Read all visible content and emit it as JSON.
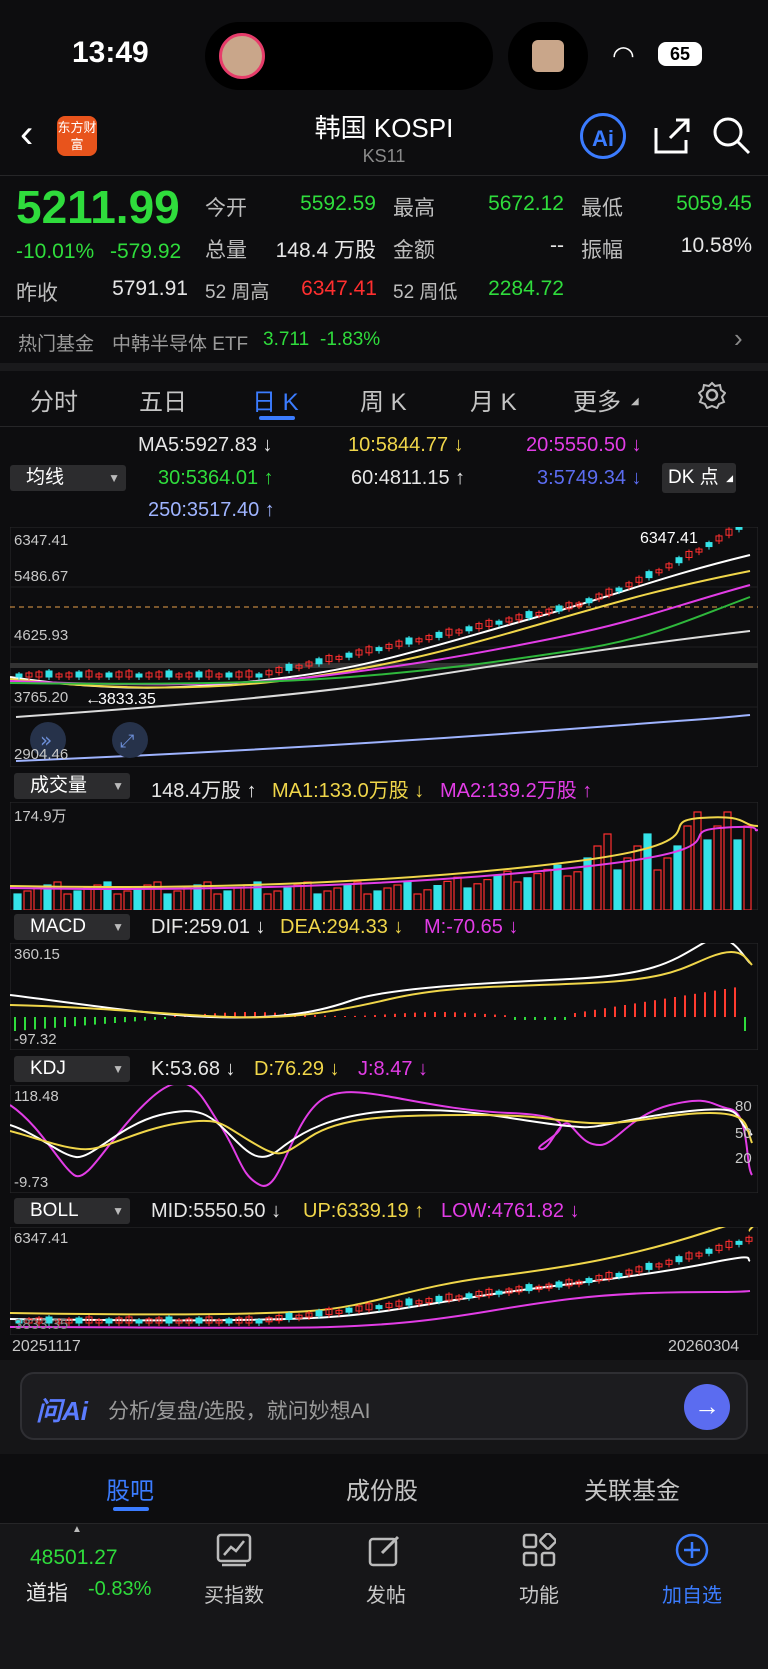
{
  "status": {
    "time": "13:49",
    "battery": "65"
  },
  "header": {
    "title": "韩国 KOSPI",
    "code": "KS11",
    "logo_text": "东方财富",
    "ai_label": "Ai"
  },
  "quote": {
    "price": "5211.99",
    "change_pct": "-10.01%",
    "change": "-579.92",
    "open_label": "今开",
    "open": "5592.59",
    "high_label": "最高",
    "high": "5672.12",
    "low_label": "最低",
    "low": "5059.45",
    "volume_label": "总量",
    "volume": "148.4 万股",
    "amount_label": "金额",
    "amount": "--",
    "amplitude_label": "振幅",
    "amplitude": "10.58%",
    "prev_close_label": "昨收",
    "prev_close": "5791.91",
    "w52_high_label": "52 周高",
    "w52_high": "6347.41",
    "w52_low_label": "52 周低",
    "w52_low": "2284.72"
  },
  "fund": {
    "label": "热门基金",
    "name": "中韩半导体 ETF",
    "price": "3.711",
    "change": "-1.83%"
  },
  "tabs": [
    "分时",
    "五日",
    "日 K",
    "周 K",
    "月 K",
    "更多"
  ],
  "ma": {
    "selector": "均线",
    "ma5": "MA5:5927.83 ↓",
    "ma10": "10:5844.77 ↓",
    "ma20": "20:5550.50 ↓",
    "ma30": "30:5364.01 ↑",
    "ma60": "60:4811.15 ↑",
    "ma3": "3:5749.34 ↓",
    "ma250": "250:3517.40 ↑",
    "dk": "DK 点"
  },
  "kline": {
    "p_top": "6347.41",
    "p2": "5486.67",
    "p3": "4625.93",
    "p4": "3765.20",
    "p_bot": "2904.46",
    "max_mark": "6347.41",
    "min_mark": "3833.35"
  },
  "volume": {
    "selector": "成交量",
    "vol": "148.4万股 ↑",
    "ma1": "MA1:133.0万股 ↓",
    "ma2": "MA2:139.2万股 ↑",
    "top": "174.9万"
  },
  "macd": {
    "selector": "MACD",
    "dif": "DIF:259.01 ↓",
    "dea": "DEA:294.33 ↓",
    "m": "M:-70.65 ↓",
    "top": "360.15",
    "bot": "-97.32"
  },
  "kdj": {
    "selector": "KDJ",
    "k": "K:53.68 ↓",
    "d": "D:76.29 ↓",
    "j": "J:8.47 ↓",
    "top": "118.48",
    "bot": "-9.73",
    "l80": "80",
    "l50": "50",
    "l20": "20"
  },
  "boll": {
    "selector": "BOLL",
    "mid": "MID:5550.50 ↓",
    "up": "UP:6339.19 ↑",
    "low": "LOW:4761.82 ↓",
    "top": "6347.41",
    "bot": "3833.35"
  },
  "dates": {
    "start": "20251117",
    "end": "20260304"
  },
  "ask": {
    "brand": "问Ai",
    "placeholder": "分析/复盘/选股，就问妙想AI"
  },
  "bottom_tabs": [
    "股吧",
    "成份股",
    "关联基金"
  ],
  "footer": {
    "dow_value": "48501.27",
    "dow_label": "道指",
    "dow_change": "-0.83%",
    "items": [
      "买指数",
      "发帖",
      "功能",
      "加自选"
    ]
  }
}
